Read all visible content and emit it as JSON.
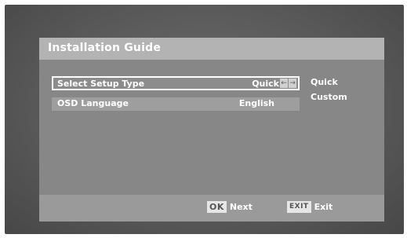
{
  "dialog": {
    "title": "Installation Guide"
  },
  "settings": [
    {
      "label": "Select Setup Type",
      "value": "Quick",
      "selected": true
    },
    {
      "label": "OSD Language",
      "value": "English",
      "selected": false
    }
  ],
  "setup_type_options": [
    "Quick",
    "Custom"
  ],
  "arrows": {
    "left": "←",
    "right": "→"
  },
  "footer": {
    "ok_key": "OK",
    "ok_label": "Next",
    "exit_key": "EXIT",
    "exit_label": "Exit"
  },
  "colors": {
    "title_bar": "#b3b3b3",
    "panel": "#878787",
    "footer": "#9a9a9a",
    "text": "#ffffff"
  }
}
